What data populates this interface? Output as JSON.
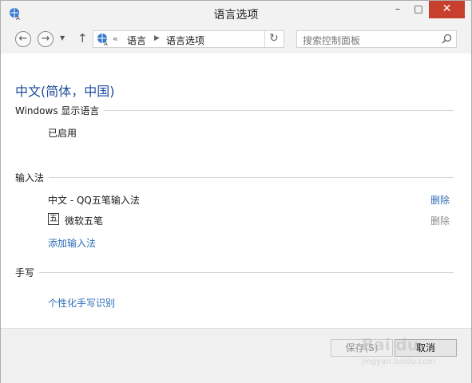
{
  "window": {
    "title": "语言选项",
    "controls": {
      "minimize": "–",
      "maximize": "□",
      "close": "✕"
    }
  },
  "nav": {
    "back_icon": "←",
    "forward_icon": "→",
    "dropdown_icon": "▼",
    "up_icon": "↑",
    "breadcrumb_prefix": "«",
    "breadcrumb": [
      "语言",
      "语言选项"
    ],
    "breadcrumb_sep": "▶",
    "refresh_icon": "↻",
    "search_placeholder": "搜索控制面板"
  },
  "content": {
    "language_title": "中文(简体，中国)",
    "display_language": {
      "heading": "Windows 显示语言",
      "status": "已启用"
    },
    "input_methods": {
      "heading": "输入法",
      "items": [
        {
          "label": "中文 - QQ五笔输入法",
          "remove": "删除",
          "remove_enabled": true
        },
        {
          "icon_char": "五",
          "label": "微软五笔",
          "remove": "删除",
          "remove_enabled": false
        }
      ],
      "add_link": "添加输入法"
    },
    "handwriting": {
      "heading": "手写",
      "personalize_link": "个性化手写识别"
    }
  },
  "footer": {
    "save_label": "保存(S)",
    "cancel_label": "取消"
  },
  "watermark": {
    "text": "Bai du",
    "sub": "jingyan.baidu.com"
  },
  "colors": {
    "link": "#2b6cb7",
    "title": "#1d4b9c",
    "close": "#c7402e"
  }
}
